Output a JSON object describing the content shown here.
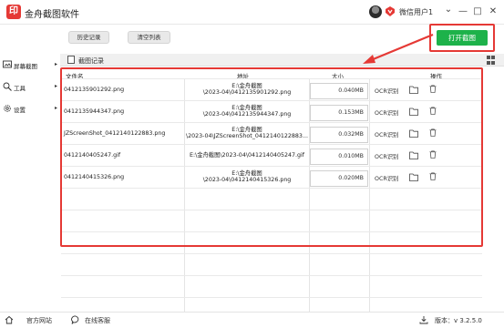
{
  "window": {
    "logo_char": "印",
    "title": "金舟截图软件",
    "user_name": "微信用户1",
    "controls": [
      "—",
      "□",
      "✕"
    ],
    "chevron": "⌄"
  },
  "toolbar": {
    "history_label": "历史记录",
    "clear_label": "清空列表",
    "open_screenshot_label": "打开截图"
  },
  "sidebar": {
    "items": [
      {
        "label": "屏幕截图",
        "icon": "screen-icon"
      },
      {
        "label": "工具",
        "icon": "tools-icon"
      },
      {
        "label": "设置",
        "icon": "gear-icon"
      }
    ]
  },
  "panel": {
    "title": "截图记录"
  },
  "table": {
    "columns": [
      "文件名",
      "地址",
      "大小",
      "操作"
    ],
    "rows": [
      {
        "name": "0412135901292.png",
        "addr1": "E:\\金舟截图",
        "addr2": "\\2023-04\\0412135901292.png",
        "size": "0.040MB",
        "action": "OCR识别"
      },
      {
        "name": "0412135944347.png",
        "addr1": "E:\\金舟截图",
        "addr2": "\\2023-04\\0412135944347.png",
        "size": "0.153MB",
        "action": "OCR识别"
      },
      {
        "name": "JZScreenShot_0412140122883.png",
        "addr1": "E:\\金舟截图",
        "addr2": "\\2023-04\\JZScreenShot_0412140122883...",
        "size": "0.032MB",
        "action": "OCR识别"
      },
      {
        "name": "0412140405247.gif",
        "addr1": "E:\\金舟截图\\2023-04\\0412140405247.gif",
        "addr2": "",
        "size": "0.010MB",
        "action": "OCR识别"
      },
      {
        "name": "0412140415326.png",
        "addr1": "E:\\金舟截图",
        "addr2": "\\2023-04\\0412140415326.png",
        "size": "0.020MB",
        "action": "OCR识别"
      }
    ]
  },
  "footer": {
    "website_label": "官方网站",
    "support_label": "在线客服",
    "version_label": "版本：v 3.2.5.0"
  },
  "colors": {
    "accent_green": "#1db24a",
    "brand_red": "#e53935",
    "annotation_red": "#e53935"
  }
}
